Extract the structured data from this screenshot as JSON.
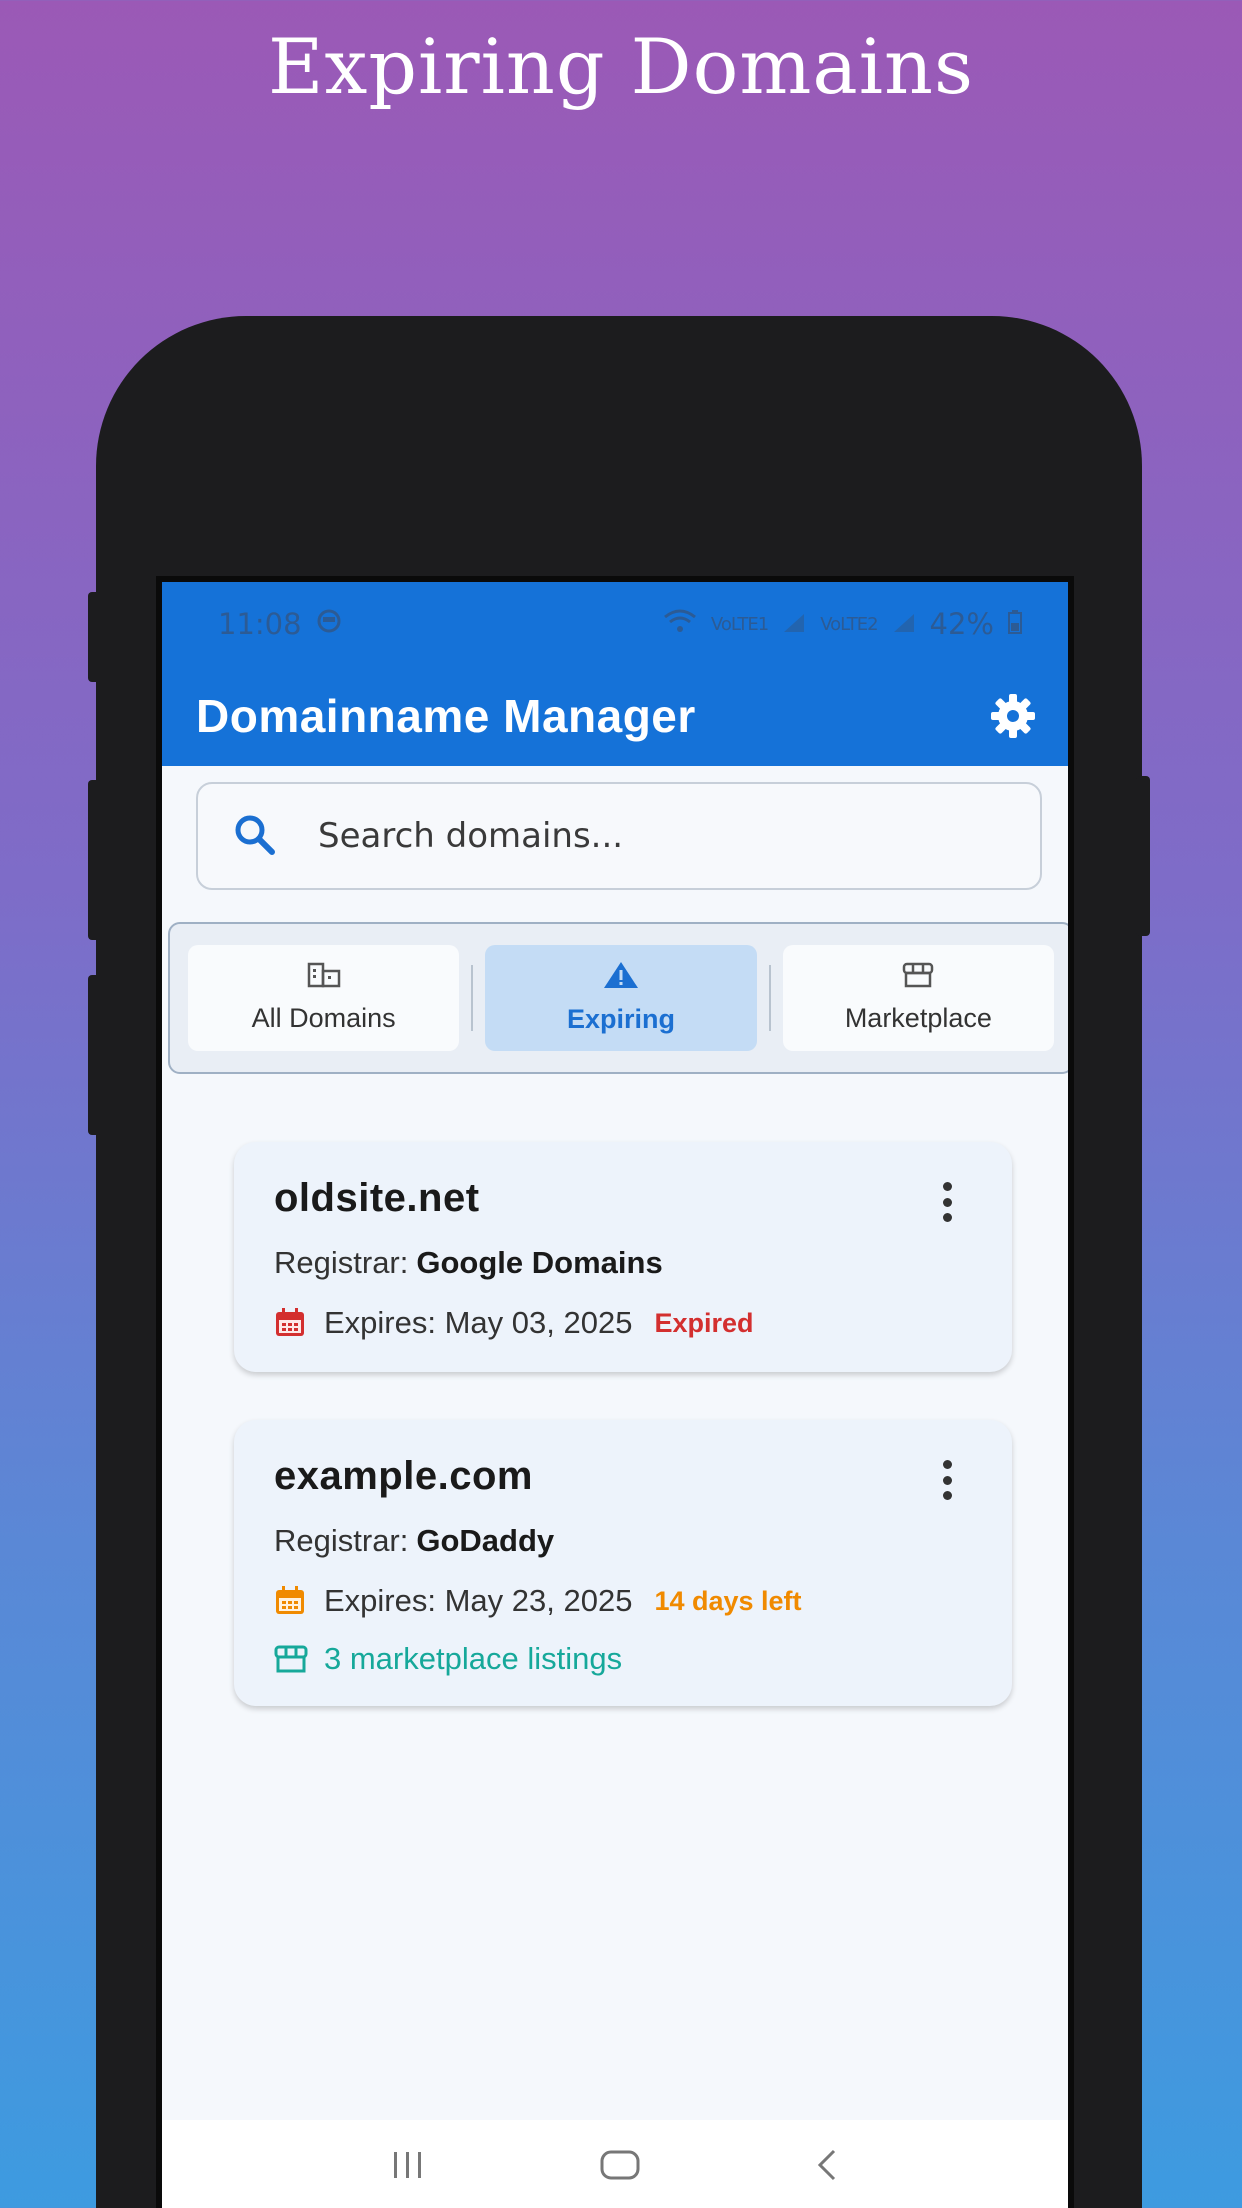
{
  "headline": "Expiring Domains",
  "status_bar": {
    "time": "11:08",
    "signal_1": "VoLTE1",
    "signal_2": "VoLTE2",
    "battery": "42%"
  },
  "app_bar": {
    "title": "Domainname Manager",
    "settings_icon": "gear-icon"
  },
  "search": {
    "placeholder": "Search domains...",
    "value": ""
  },
  "tabs": [
    {
      "label": "All Domains",
      "icon": "domain-icon",
      "active": false
    },
    {
      "label": "Expiring",
      "icon": "warning-icon",
      "active": true
    },
    {
      "label": "Marketplace",
      "icon": "store-icon",
      "active": false
    }
  ],
  "domains": [
    {
      "name": "oldsite.net",
      "registrar_label": "Registrar:",
      "registrar": "Google Domains",
      "expires_label": "Expires: May 03, 2025",
      "badge": "Expired",
      "badge_color": "#d32f2f",
      "calendar_color": "#d32f2f"
    },
    {
      "name": "example.com",
      "registrar_label": "Registrar:",
      "registrar": "GoDaddy",
      "expires_label": "Expires: May 23, 2025",
      "badge": "14 days left",
      "badge_color": "#f08a00",
      "calendar_color": "#f08a00",
      "listings": "3 marketplace listings",
      "listings_color": "#16a89a"
    }
  ],
  "colors": {
    "primary": "#1572d8",
    "active_tab_bg": "#c4dcf5"
  }
}
